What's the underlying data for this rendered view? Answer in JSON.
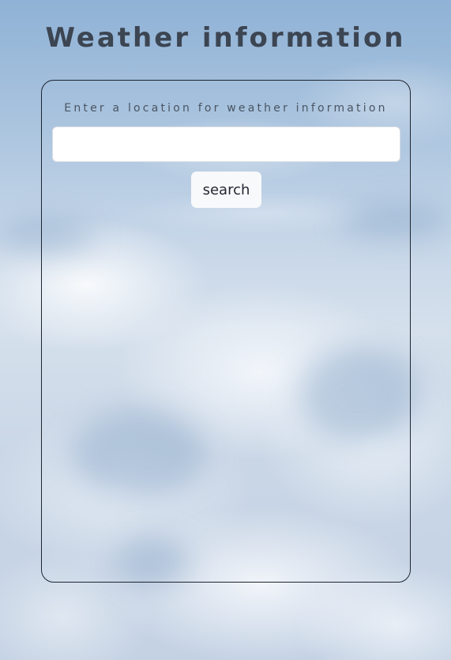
{
  "page": {
    "title": "Weather information"
  },
  "search": {
    "prompt": "Enter a location for weather information",
    "input_value": "",
    "button_label": "search"
  },
  "colors": {
    "title_text": "#3c4552",
    "panel_border": "#1d2530",
    "button_background": "#f8f9fb",
    "sky_background": "#a9c3de"
  },
  "background": {
    "image": "sky-clouds-photo"
  }
}
